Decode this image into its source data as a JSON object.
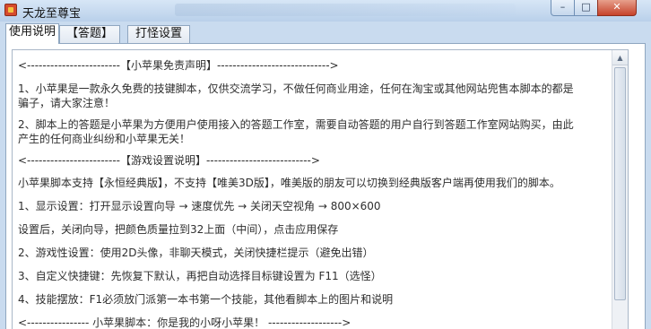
{
  "window": {
    "title": "天龙至尊宝",
    "controls": {
      "minimize": "–",
      "maximize": "□",
      "close": "✕"
    },
    "icon": "app-logo-icon"
  },
  "tabs": [
    {
      "label": "使用说明",
      "active": true
    },
    {
      "label": "【答题】",
      "active": false
    },
    {
      "label": "打怪设置",
      "active": false
    }
  ],
  "content": {
    "lines": [
      "<------------------------【小苹果免责声明】----------------------------->",
      "1、小苹果是一款永久免费的技键脚本，仅供交流学习，不做任何商业用途，任何在淘宝或其他网站兜售本脚本的都是",
      "骗子，请大家注意！",
      "2、脚本上的答题是小苹果为方便用户使用接入的答题工作室，需要自动答题的用户自行到答题工作室网站购买，由此",
      "产生的任何商业纠纷和小苹果无关！",
      "<------------------------【游戏设置说明】--------------------------->",
      "小苹果脚本支持【永恒经典版】，不支持【唯美3D版】，唯美版的朋友可以切换到经典版客户端再使用我们的脚本。",
      "1、显示设置：打开显示设置向导 → 速度优先 → 关闭天空视角 → 800×600",
      "设置后，关闭向导，把颜色质量拉到32上面（中间），点击应用保存",
      "2、游戏性设置：使用2D头像，非聊天模式，关闭快捷栏提示（避免出错）",
      "3、自定义快捷键：先恢复下默认，再把自动选择目标键设置为 F11（选怪）",
      "4、技能摆放：F1必须放门派第一本书第一个技能，其他看脚本上的图片和说明",
      "<---------------- 小苹果脚本：你是我的小呀小苹果！ ------------------->"
    ]
  }
}
